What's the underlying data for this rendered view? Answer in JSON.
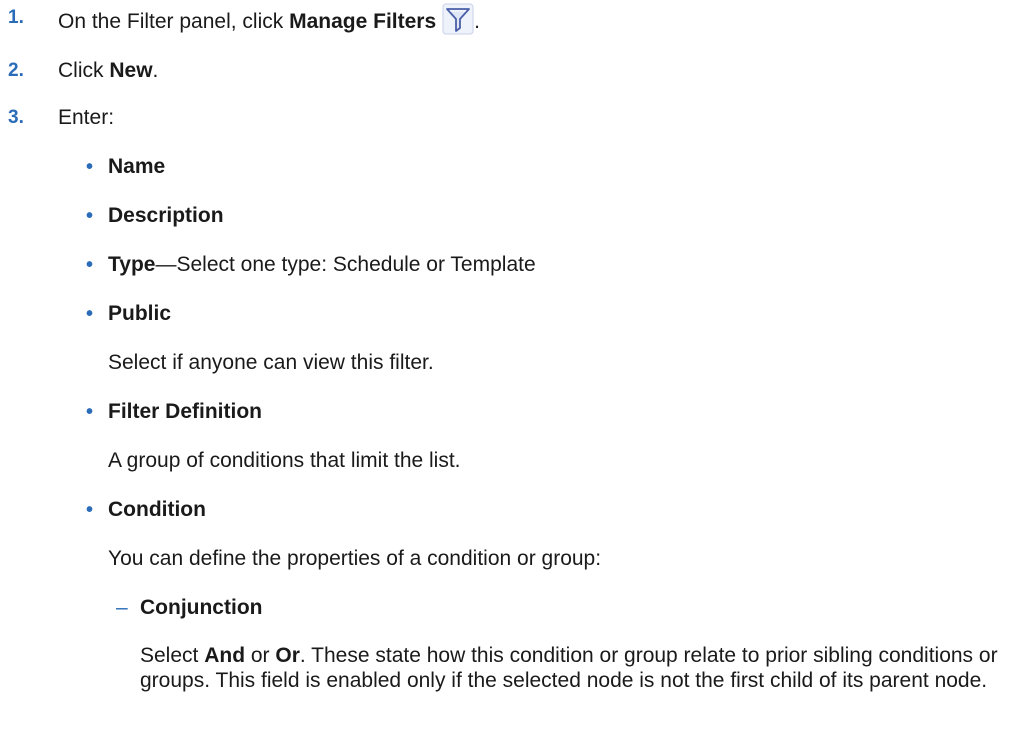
{
  "steps": [
    {
      "num": "1.",
      "pre": "On the Filter panel, click ",
      "bold": "Manage Filters",
      "post": "."
    },
    {
      "num": "2.",
      "pre": "Click ",
      "bold": "New",
      "post": "."
    },
    {
      "num": "3.",
      "pre": "Enter:"
    }
  ],
  "bullets": {
    "name": "Name",
    "description": "Description",
    "type_bold": "Type",
    "type_rest": "—Select one type: Schedule or Template",
    "public": "Public",
    "public_desc": "Select if anyone can view this filter.",
    "filter_def": "Filter Definition",
    "filter_def_desc": "A group of conditions that limit the list.",
    "condition": "Condition",
    "condition_desc": "You can define the properties of a condition or group:"
  },
  "bullet_mark": "•",
  "dash_mark": "–",
  "conjunction": {
    "label": "Conjunction",
    "pre": "Select ",
    "and": "And",
    "mid": " or ",
    "or": "Or",
    "post": ". These state how this condition or group relate to prior sibling conditions or groups. This field is enabled only if the selected node is not the first child of its parent node."
  },
  "icon": {
    "name": "filter-funnel-icon",
    "color_stroke": "#4a5fa8",
    "color_fill": "#dfe6f6"
  }
}
